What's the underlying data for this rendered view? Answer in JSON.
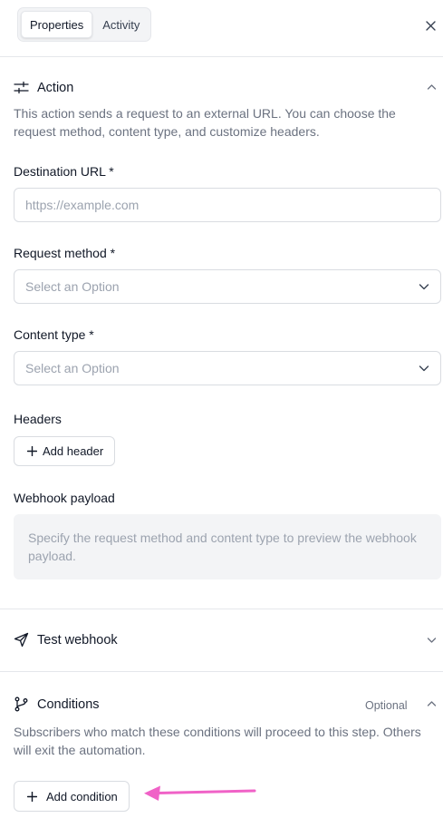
{
  "tabs": [
    {
      "label": "Properties",
      "active": true
    },
    {
      "label": "Activity",
      "active": false
    }
  ],
  "action": {
    "title": "Action",
    "description": "This action sends a request to an external URL. You can choose the request method, content type, and customize headers."
  },
  "destination_url": {
    "label": "Destination URL *",
    "placeholder": "https://example.com"
  },
  "request_method": {
    "label": "Request method *",
    "placeholder": "Select an Option"
  },
  "content_type": {
    "label": "Content type *",
    "placeholder": "Select an Option"
  },
  "headers": {
    "label": "Headers",
    "add_button": "Add header"
  },
  "webhook_payload": {
    "label": "Webhook payload",
    "placeholder": "Specify the request method and content type to preview the webhook payload."
  },
  "test_webhook": {
    "title": "Test webhook"
  },
  "conditions": {
    "title": "Conditions",
    "badge": "Optional",
    "description": "Subscribers who match these conditions will proceed to this step. Others will exit the automation.",
    "add_button": "Add condition"
  },
  "colors": {
    "annotation_arrow": "#f062c7",
    "border": "#d9dce1",
    "muted_text": "#6b7280"
  }
}
